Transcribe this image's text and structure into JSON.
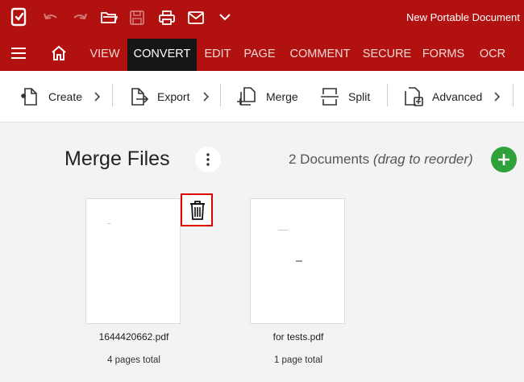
{
  "app": {
    "title": "New Portable Document",
    "accent_color": "#b1120f",
    "active_tab_color": "#161616"
  },
  "titlebar_icons": [
    "app-logo-icon",
    "undo-icon",
    "redo-icon",
    "open-folder-icon",
    "save-icon",
    "print-icon",
    "email-icon",
    "chevron-down-icon"
  ],
  "menu": {
    "hamburger_icon": "hamburger-icon",
    "home_icon": "home-icon",
    "tabs": [
      {
        "label": "VIEW"
      },
      {
        "label": "CONVERT",
        "active": true
      },
      {
        "label": "EDIT"
      },
      {
        "label": "PAGE"
      },
      {
        "label": "COMMENT"
      },
      {
        "label": "SECURE"
      },
      {
        "label": "FORMS"
      },
      {
        "label": "OCR"
      }
    ]
  },
  "toolbar": {
    "items": [
      {
        "label": "Create",
        "icon": "create-document-icon",
        "has_submenu": true
      },
      {
        "label": "Export",
        "icon": "export-icon",
        "has_submenu": true
      },
      {
        "label": "Merge",
        "icon": "merge-icon",
        "has_submenu": false
      },
      {
        "label": "Split",
        "icon": "split-icon",
        "has_submenu": false
      },
      {
        "label": "Advanced",
        "icon": "advanced-convert-icon",
        "has_submenu": true
      }
    ]
  },
  "merge": {
    "title": "Merge Files",
    "count_text": "2 Documents",
    "hint_text": "(drag to reorder)",
    "add_button_color": "#2fa13a",
    "files": [
      {
        "name": "1644420662.pdf",
        "pages": "4 pages total"
      },
      {
        "name": "for tests.pdf",
        "pages": "1 page total"
      }
    ]
  }
}
